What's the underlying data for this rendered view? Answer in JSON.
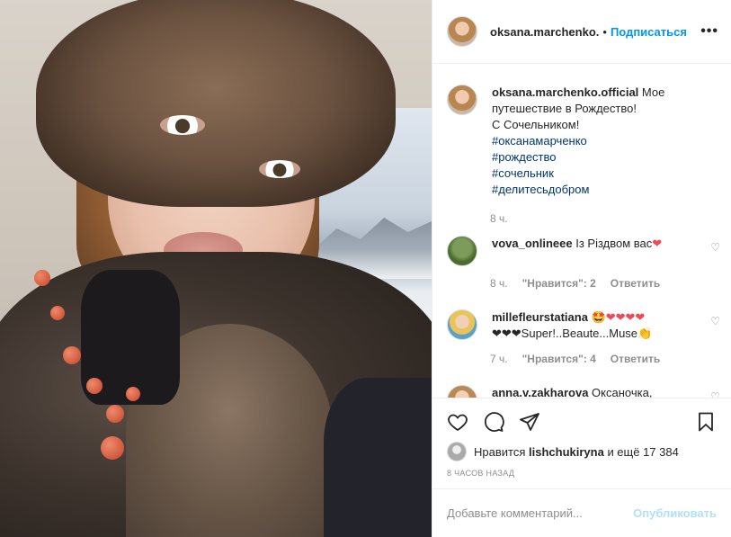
{
  "header": {
    "username": "oksana.marchenko.",
    "dot": "•",
    "follow_label": "Подписаться",
    "more_icon": "more-horizontal-icon"
  },
  "caption": {
    "username": "oksana.marchenko.official",
    "text_line1": "Мое путешествие в Рождество!",
    "text_line2": "С Сочельником!",
    "hashtags": [
      "#оксанамарченко",
      "#рождество",
      "#сочельник",
      "#делитесьдобром"
    ],
    "time": "8 ч."
  },
  "comments": [
    {
      "username": "vova_onlineee",
      "text": "Із Різдвом вас",
      "emoji": "❤",
      "time": "8 ч.",
      "likes_label": "\"Нравится\": 2",
      "reply_label": "Ответить"
    },
    {
      "username": "millefleurstatiana",
      "emoji_line": "🤩❤❤❤❤",
      "text": "❤❤❤Super!..Beaute...Muse👏",
      "time": "7 ч.",
      "likes_label": "\"Нравится\": 4",
      "reply_label": "Ответить"
    },
    {
      "username": "anna.v.zakharova",
      "text": "Оксаночка,"
    }
  ],
  "actions": {
    "like_icon": "heart-icon",
    "comment_icon": "comment-icon",
    "share_icon": "send-icon",
    "save_icon": "bookmark-icon"
  },
  "likes": {
    "prefix": "Нравится",
    "user": "lishchukiryna",
    "suffix": "и ещё 17 384"
  },
  "posted_time": "8 ЧАСОВ НАЗАД",
  "add_comment": {
    "placeholder": "Добавьте комментарий...",
    "publish_label": "Опубликовать"
  },
  "colors": {
    "accent": "#0095f6",
    "hashtag": "#00376b",
    "muted": "#8e8e8e",
    "publish_disabled": "#b2dffc",
    "heart": "#ed4956"
  }
}
